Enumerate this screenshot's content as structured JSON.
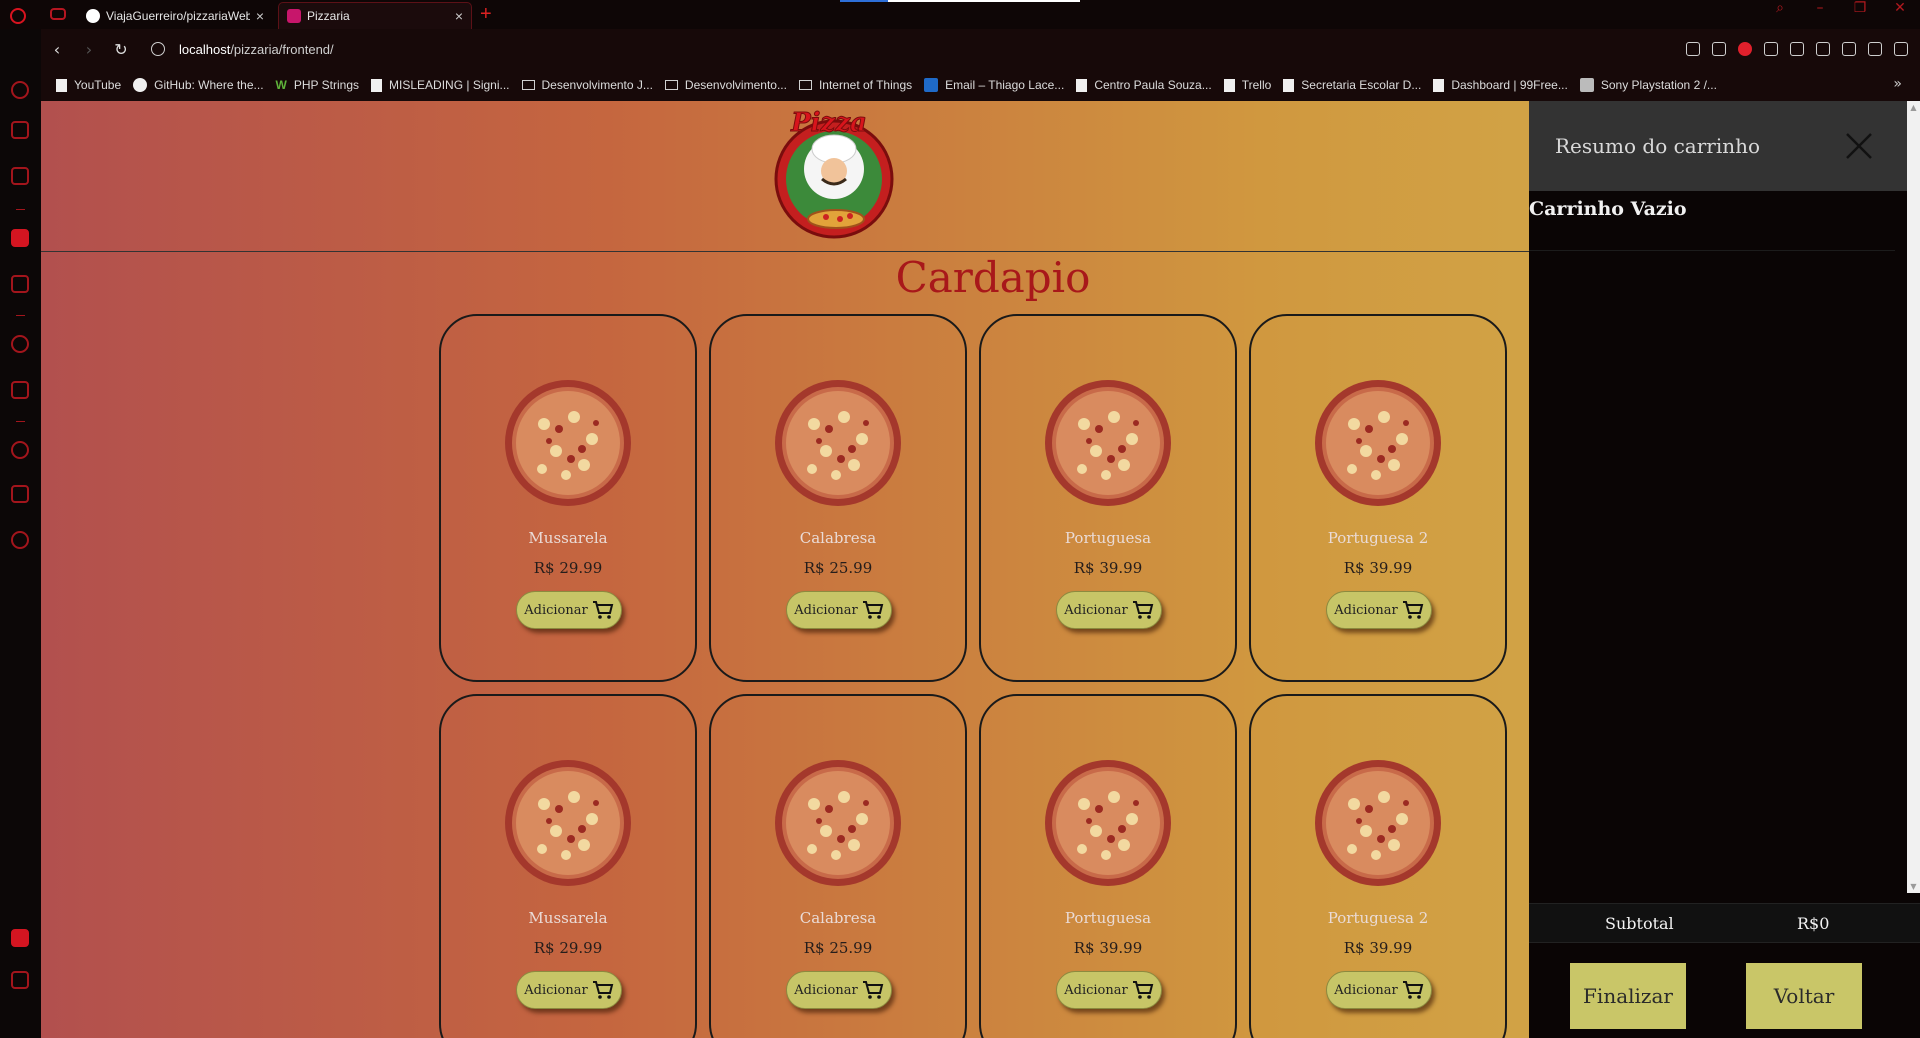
{
  "browser": {
    "tabs": [
      {
        "title": "ViajaGuerreiro/pizzariaWeb",
        "active": false
      },
      {
        "title": "Pizzaria",
        "active": true
      }
    ],
    "new_tab": "+",
    "window_controls": {
      "search": "⌕",
      "minimize": "–",
      "restore": "❐",
      "close": "✕"
    },
    "address": {
      "host": "localhost",
      "path": "/pizzaria/frontend/"
    },
    "bookmarks": [
      {
        "label": "YouTube",
        "icon": "page-icon"
      },
      {
        "label": "GitHub: Where the...",
        "icon": "github-icon"
      },
      {
        "label": "PHP Strings",
        "icon": "w3-icon"
      },
      {
        "label": "MISLEADING | Signi...",
        "icon": "page-icon"
      },
      {
        "label": "Desenvolvimento J...",
        "icon": "folder-icon"
      },
      {
        "label": "Desenvolvimento...",
        "icon": "folder-icon"
      },
      {
        "label": "Internet of Things",
        "icon": "folder-icon"
      },
      {
        "label": "Email – Thiago Lace...",
        "icon": "outlook-icon"
      },
      {
        "label": "Centro Paula Souza...",
        "icon": "page-icon"
      },
      {
        "label": "Trello",
        "icon": "page-icon"
      },
      {
        "label": "Secretaria Escolar D...",
        "icon": "page-icon"
      },
      {
        "label": "Dashboard | 99Free...",
        "icon": "page-icon"
      },
      {
        "label": "Sony Playstation 2 /...",
        "icon": "playstation-icon"
      }
    ],
    "bookmarks_more": "»"
  },
  "page": {
    "menu_title": "Cardapio",
    "products": [
      {
        "name": "Mussarela",
        "price": "R$ 29.99",
        "button": "Adicionar"
      },
      {
        "name": "Calabresa",
        "price": "R$ 25.99",
        "button": "Adicionar"
      },
      {
        "name": "Portuguesa",
        "price": "R$ 39.99",
        "button": "Adicionar"
      },
      {
        "name": "Portuguesa 2",
        "price": "R$ 39.99",
        "button": "Adicionar"
      },
      {
        "name": "Mussarela",
        "price": "R$ 29.99",
        "button": "Adicionar"
      },
      {
        "name": "Calabresa",
        "price": "R$ 25.99",
        "button": "Adicionar"
      },
      {
        "name": "Portuguesa",
        "price": "R$ 39.99",
        "button": "Adicionar"
      },
      {
        "name": "Portuguesa 2",
        "price": "R$ 39.99",
        "button": "Adicionar"
      }
    ]
  },
  "cart": {
    "title": "Resumo do carrinho",
    "empty_text": "Carrinho Vazio",
    "subtotal_label": "Subtotal",
    "subtotal_value": "R$0",
    "finalize_label": "Finalizar",
    "back_label": "Voltar"
  },
  "colors": {
    "accent_red": "#a8181a",
    "button_yellow": "#c9c668",
    "cart_header": "#333333",
    "gradient": [
      "#b2504e",
      "#d3b24f"
    ]
  }
}
